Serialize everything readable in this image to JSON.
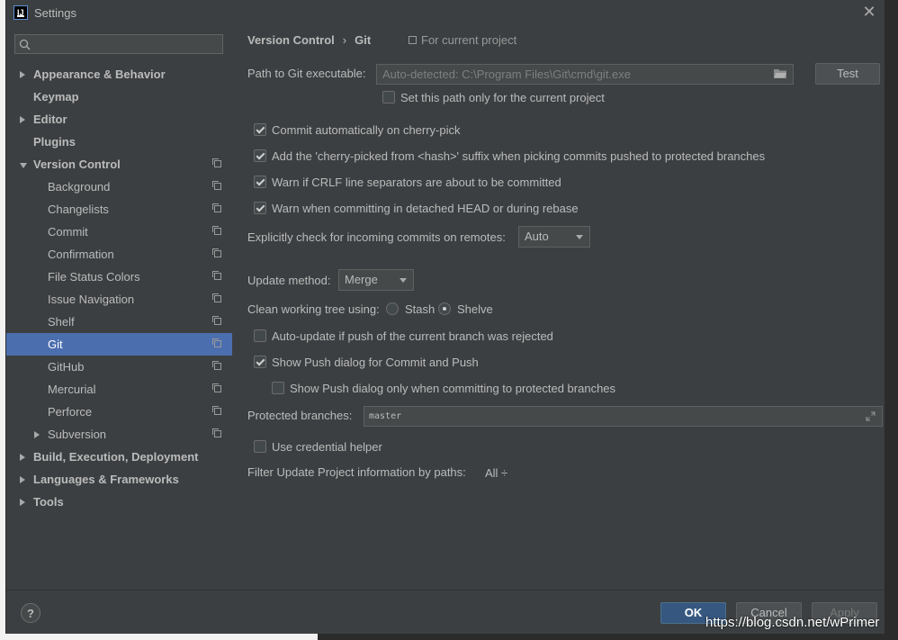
{
  "window": {
    "title": "Settings"
  },
  "sidebar": {
    "search_placeholder": "",
    "items": [
      {
        "label": "Appearance & Behavior",
        "bold": true,
        "arrow": "right"
      },
      {
        "label": "Keymap",
        "bold": true
      },
      {
        "label": "Editor",
        "bold": true,
        "arrow": "right"
      },
      {
        "label": "Plugins",
        "bold": true
      },
      {
        "label": "Version Control",
        "bold": true,
        "arrow": "down",
        "project_icon": true
      },
      {
        "label": "Background",
        "project_icon": true
      },
      {
        "label": "Changelists",
        "project_icon": true
      },
      {
        "label": "Commit",
        "project_icon": true
      },
      {
        "label": "Confirmation",
        "project_icon": true
      },
      {
        "label": "File Status Colors",
        "project_icon": true
      },
      {
        "label": "Issue Navigation",
        "project_icon": true
      },
      {
        "label": "Shelf",
        "project_icon": true
      },
      {
        "label": "Git",
        "project_icon": true,
        "selected": true
      },
      {
        "label": "GitHub",
        "project_icon": true
      },
      {
        "label": "Mercurial",
        "project_icon": true
      },
      {
        "label": "Perforce",
        "project_icon": true
      },
      {
        "label": "Subversion",
        "arrow": "right",
        "project_icon": true
      },
      {
        "label": "Build, Execution, Deployment",
        "bold": true,
        "arrow": "right"
      },
      {
        "label": "Languages & Frameworks",
        "bold": true,
        "arrow": "right"
      },
      {
        "label": "Tools",
        "bold": true,
        "arrow": "right"
      }
    ]
  },
  "panel": {
    "breadcrumb": [
      "Version Control",
      "Git"
    ],
    "breadcrumb_sep": "›",
    "for_current_project": "For current project",
    "path_label": "Path to Git executable:",
    "path_value": "Auto-detected: C:\\Program Files\\Git\\cmd\\git.exe",
    "test_button": "Test",
    "set_path_only": {
      "label": "Set this path only for the current project",
      "checked": false
    },
    "checkboxes": [
      {
        "label": "Commit automatically on cherry-pick",
        "checked": true
      },
      {
        "label": "Add the 'cherry-picked from <hash>' suffix when picking commits pushed to protected branches",
        "checked": true
      },
      {
        "label": "Warn if CRLF line separators are about to be committed",
        "checked": true
      },
      {
        "label": "Warn when committing in detached HEAD or during rebase",
        "checked": true
      }
    ],
    "incoming_label": "Explicitly check for incoming commits on remotes:",
    "incoming_value": "Auto",
    "update_method_label": "Update method:",
    "update_method_value": "Merge",
    "clean_tree_label": "Clean working tree using:",
    "stash_label": "Stash",
    "shelve_label": "Shelve",
    "clean_tree_selected": "Shelve",
    "auto_update": {
      "label": "Auto-update if push of the current branch was rejected",
      "checked": false
    },
    "show_push": {
      "label": "Show Push dialog for Commit and Push",
      "checked": true
    },
    "show_push_protected": {
      "label": "Show Push dialog only when committing to protected branches",
      "checked": false
    },
    "protected_label": "Protected branches:",
    "protected_value": "master",
    "credential_helper": {
      "label": "Use credential helper",
      "checked": false
    },
    "filter_label": "Filter Update Project information by paths:",
    "filter_value": "All ÷"
  },
  "footer": {
    "help": "?",
    "ok": "OK",
    "cancel": "Cancel",
    "apply": "Apply"
  },
  "watermark": "https://blog.csdn.net/wPrimer",
  "colors": {
    "accent_selected": "#4b6eaf",
    "background": "#3c3f41",
    "ok_button": "#365880"
  }
}
